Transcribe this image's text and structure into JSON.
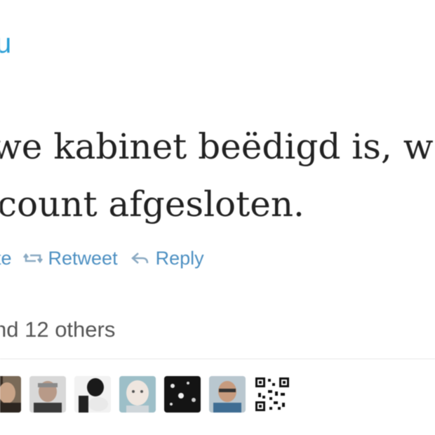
{
  "header": {
    "handle_fragment": "u"
  },
  "tweet": {
    "lines": [
      "we kabinet beëdigd is, w",
      "count afgesloten."
    ]
  },
  "actions": {
    "favorite_label": "te",
    "retweet_label": "Retweet",
    "reply_label": "Reply"
  },
  "favorites": {
    "summary": "nd 12 others"
  },
  "colors": {
    "link": "#4d90c2",
    "text": "#222222",
    "muted": "#555555",
    "divider": "#e6e6e6"
  },
  "avatars": [
    {
      "icon": "avatar-icon"
    },
    {
      "icon": "avatar-icon"
    },
    {
      "icon": "avatar-icon"
    },
    {
      "icon": "avatar-icon"
    },
    {
      "icon": "avatar-icon"
    },
    {
      "icon": "avatar-icon"
    },
    {
      "icon": "qr-code-icon"
    }
  ]
}
